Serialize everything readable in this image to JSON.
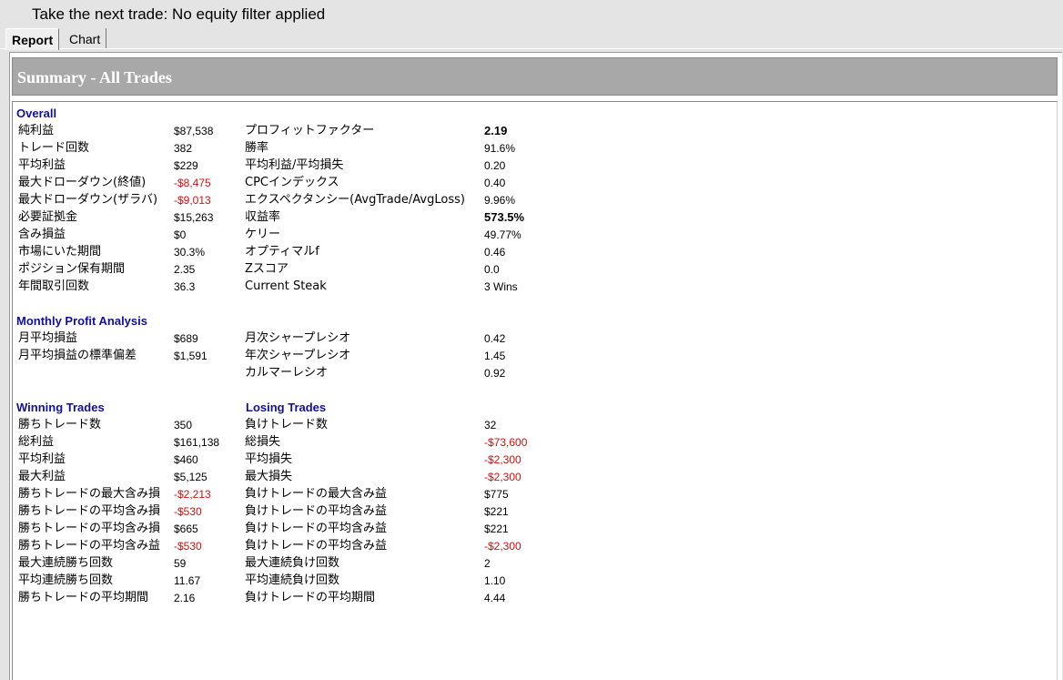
{
  "window": {
    "title": "Take the next trade: No equity filter applied"
  },
  "tabs": [
    {
      "label": "Report",
      "active": true
    },
    {
      "label": "Chart",
      "active": false
    }
  ],
  "summary": {
    "title": "Summary - All Trades"
  },
  "sections": {
    "overall": "Overall",
    "monthly": "Monthly Profit Analysis",
    "winning": "Winning Trades",
    "losing": "Losing Trades"
  },
  "overall_left": [
    {
      "label": "純利益",
      "value": "$87,538",
      "negative": false
    },
    {
      "label": "トレード回数",
      "value": "382",
      "negative": false
    },
    {
      "label": "平均利益",
      "value": "$229",
      "negative": false
    },
    {
      "label": "最大ドローダウン(終値)",
      "value": "-$8,475",
      "negative": true
    },
    {
      "label": "最大ドローダウン(ザラバ)",
      "value": "-$9,013",
      "negative": true
    },
    {
      "label": "必要証拠金",
      "value": "$15,263",
      "negative": false
    },
    {
      "label": "含み損益",
      "value": "$0",
      "negative": false
    },
    {
      "label": "市場にいた期間",
      "value": "30.3%",
      "negative": false
    },
    {
      "label": "ポジション保有期間",
      "value": "2.35",
      "negative": false
    },
    {
      "label": "年間取引回数",
      "value": "36.3",
      "negative": false
    }
  ],
  "overall_right": [
    {
      "label": "プロフィットファクター",
      "value": "2.19",
      "bold": true
    },
    {
      "label": "勝率",
      "value": "91.6%",
      "bold": false
    },
    {
      "label": "平均利益/平均損失",
      "value": "0.20",
      "bold": false
    },
    {
      "label": "CPCインデックス",
      "value": "0.40",
      "bold": false
    },
    {
      "label": "エクスペクタンシー(AvgTrade/AvgLoss)",
      "value": "9.96%",
      "bold": false
    },
    {
      "label": "収益率",
      "value": "573.5%",
      "bold": true
    },
    {
      "label": "ケリー",
      "value": "49.77%",
      "bold": false
    },
    {
      "label": "オプティマルf",
      "value": "0.46",
      "bold": false
    },
    {
      "label": "Zスコア",
      "value": "0.0",
      "bold": false
    },
    {
      "label": "Current Steak",
      "value": "3 Wins",
      "bold": false
    }
  ],
  "monthly_left": [
    {
      "label": "月平均損益",
      "value": "$689"
    },
    {
      "label": "月平均損益の標準偏差",
      "value": "$1,591"
    }
  ],
  "monthly_right": [
    {
      "label": "月次シャープレシオ",
      "value": "0.42"
    },
    {
      "label": "年次シャープレシオ",
      "value": "1.45"
    },
    {
      "label": "カルマーレシオ",
      "value": "0.92"
    }
  ],
  "winning": [
    {
      "label": "勝ちトレード数",
      "value": "350",
      "negative": false
    },
    {
      "label": "総利益",
      "value": "$161,138",
      "negative": false
    },
    {
      "label": "平均利益",
      "value": "$460",
      "negative": false
    },
    {
      "label": "最大利益",
      "value": "$5,125",
      "negative": false
    },
    {
      "label": "勝ちトレードの最大含み損",
      "value": "-$2,213",
      "negative": true
    },
    {
      "label": "勝ちトレードの平均含み損",
      "value": "-$530",
      "negative": true
    },
    {
      "label": "勝ちトレードの平均含み損",
      "value": "$665",
      "negative": false
    },
    {
      "label": "勝ちトレードの平均含み益",
      "value": "-$530",
      "negative": true
    },
    {
      "label": "最大連続勝ち回数",
      "value": "59",
      "negative": false
    },
    {
      "label": "平均連続勝ち回数",
      "value": "11.67",
      "negative": false
    },
    {
      "label": "勝ちトレードの平均期間",
      "value": "2.16",
      "negative": false
    }
  ],
  "losing": [
    {
      "label": "負けトレード数",
      "value": "32",
      "negative": false
    },
    {
      "label": "総損失",
      "value": "-$73,600",
      "negative": true
    },
    {
      "label": "平均損失",
      "value": "-$2,300",
      "negative": true
    },
    {
      "label": "最大損失",
      "value": "-$2,300",
      "negative": true
    },
    {
      "label": "負けトレードの最大含み益",
      "value": "$775",
      "negative": false
    },
    {
      "label": "負けトレードの平均含み益",
      "value": "$221",
      "negative": false
    },
    {
      "label": "負けトレードの平均含み益",
      "value": "$221",
      "negative": false
    },
    {
      "label": "負けトレードの平均含み益",
      "value": "-$2,300",
      "negative": true
    },
    {
      "label": "最大連続負け回数",
      "value": "2",
      "negative": false
    },
    {
      "label": "平均連続負け回数",
      "value": "1.10",
      "negative": false
    },
    {
      "label": "負けトレードの平均期間",
      "value": "4.44",
      "negative": false
    }
  ]
}
